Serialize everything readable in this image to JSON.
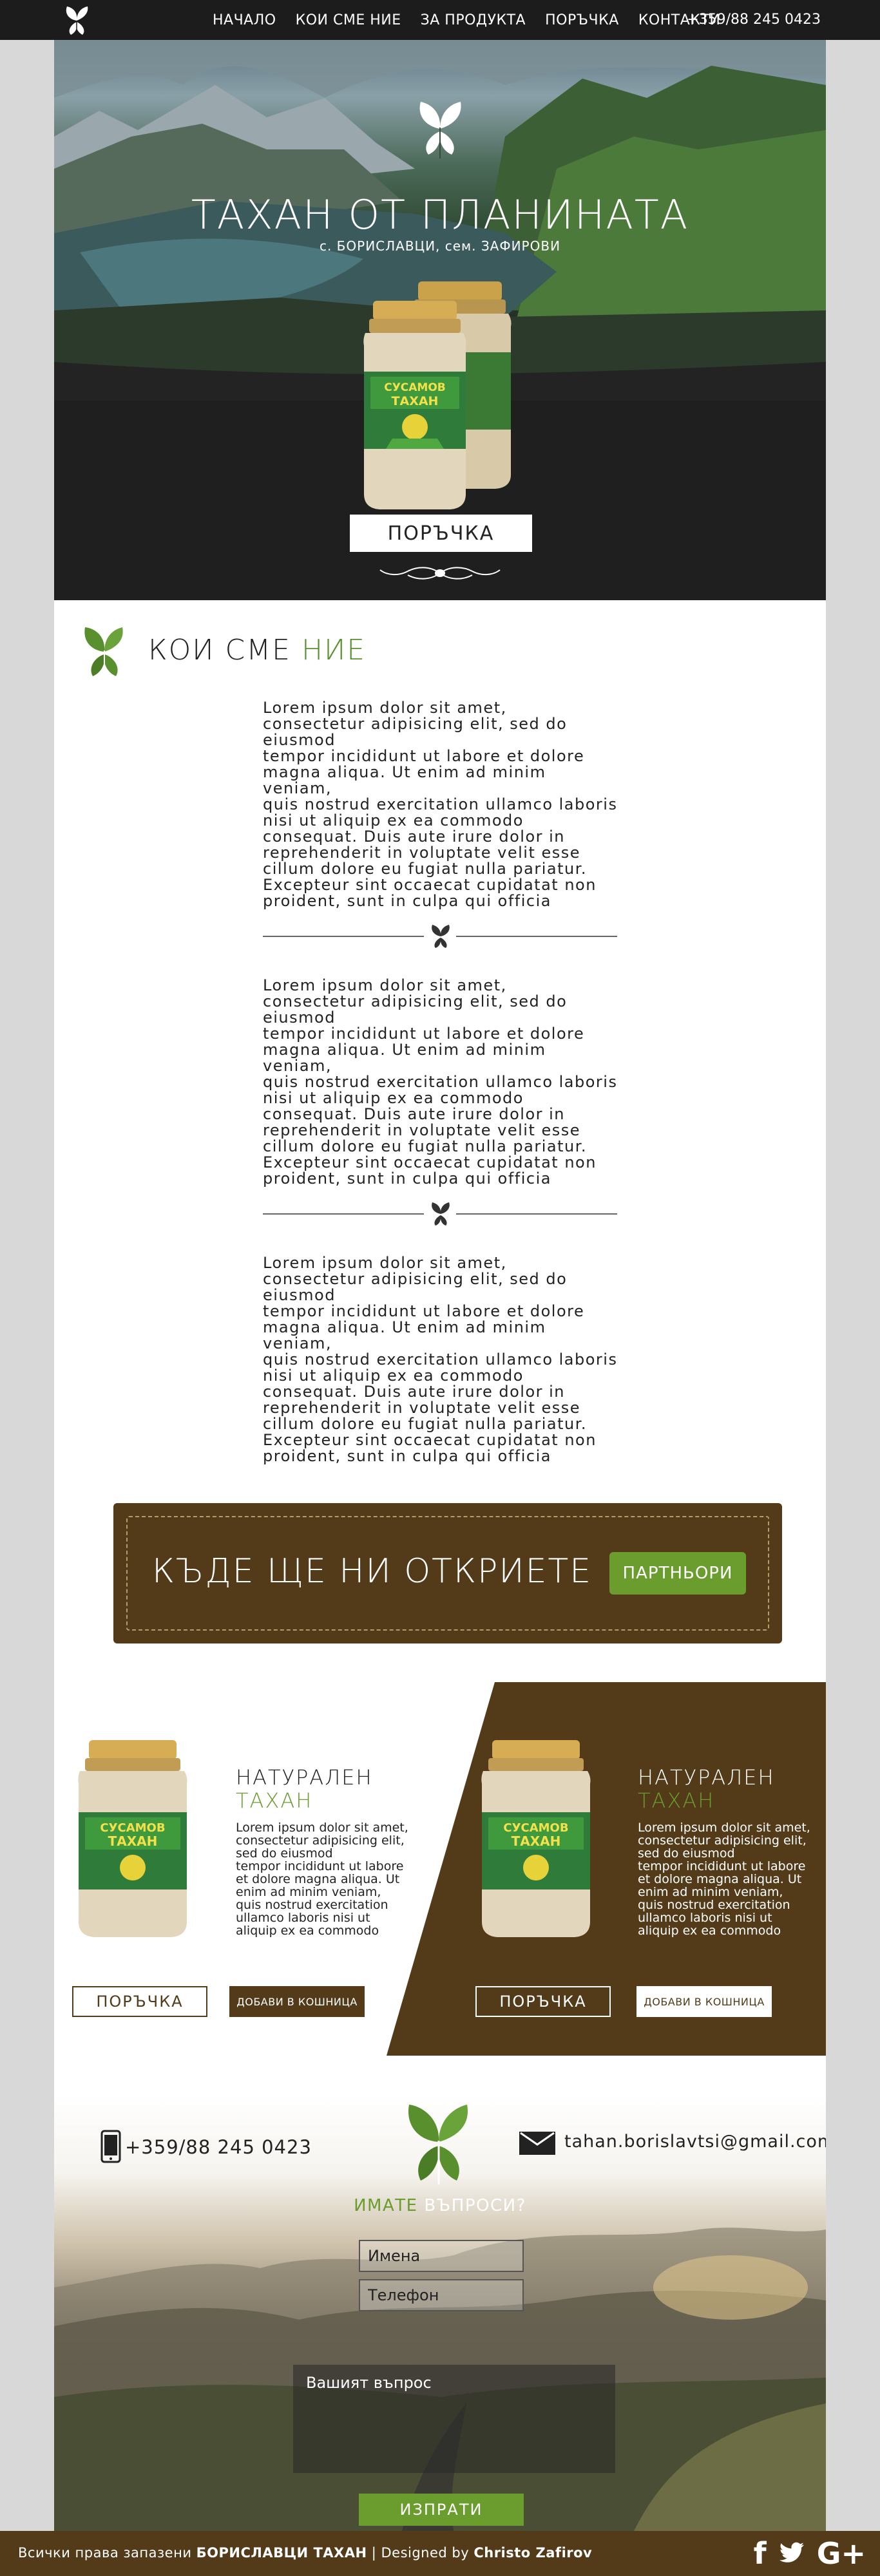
{
  "nav": {
    "links": [
      "НАЧАЛО",
      "КОИ СМЕ НИЕ",
      "ЗА ПРОДУКТА",
      "ПОРЪЧКА",
      "КОНТАКТИ"
    ],
    "phone": "+359/88 245 0423"
  },
  "hero": {
    "title": "ТАХАН ОТ ПЛАНИНАТА",
    "subtitle": "с. БОРИСЛАВЦИ, сем. ЗАФИРОВИ",
    "jar_label_top": "СУСАМОВ",
    "jar_label_bottom": "ТАХАН",
    "order_button": "ПОРЪЧКА"
  },
  "about": {
    "title_main": "КОИ СМЕ ",
    "title_accent": "НИЕ",
    "paragraphs": [
      "      Lorem ipsum dolor sit amet,\nconsectetur adipisicing elit, sed do\neiusmod\ntempor incididunt ut labore et dolore\nmagna aliqua. Ut enim ad minim\nveniam,\nquis nostrud exercitation ullamco laboris\nnisi ut aliquip ex ea commodo\nconsequat. Duis aute irure dolor in\nreprehenderit in voluptate velit esse\ncillum dolore eu fugiat nulla pariatur.\nExcepteur sint occaecat cupidatat non\nproident, sunt in culpa qui officia",
      "      Lorem ipsum dolor sit amet,\nconsectetur adipisicing elit, sed do\neiusmod\ntempor incididunt ut labore et dolore\nmagna aliqua. Ut enim ad minim\nveniam,\nquis nostrud exercitation ullamco laboris\nnisi ut aliquip ex ea commodo\nconsequat. Duis aute irure dolor in\nreprehenderit in voluptate velit esse\ncillum dolore eu fugiat nulla pariatur.\nExcepteur sint occaecat cupidatat non\nproident, sunt in culpa qui officia",
      "      Lorem ipsum dolor sit amet,\nconsectetur adipisicing elit, sed do\neiusmod\ntempor incididunt ut labore et dolore\nmagna aliqua. Ut enim ad minim\nveniam,\nquis nostrud exercitation ullamco laboris\nnisi ut aliquip ex ea commodo\nconsequat. Duis aute irure dolor in\nreprehenderit in voluptate velit esse\ncillum dolore eu fugiat nulla pariatur.\nExcepteur sint occaecat cupidatat non\nproident, sunt in culpa qui officia"
    ]
  },
  "find": {
    "title": "КЪДЕ ЩЕ НИ ОТКРИЕТЕ",
    "button": "ПАРТНЬОРИ"
  },
  "products": [
    {
      "title_main": "НАТУРАЛЕН",
      "title_accent": "ТАХАН",
      "description": "Lorem ipsum dolor sit amet,\nconsectetur adipisicing elit,\nsed do eiusmod\ntempor incididunt ut labore\net dolore magna aliqua. Ut\nenim ad minim veniam,\nquis nostrud exercitation\nullamco laboris nisi ut\naliquip ex ea commodo",
      "order_button": "ПОРЪЧКА",
      "cart_button": "ДОБАВИ В КОШНИЦА"
    },
    {
      "title_main": "НАТУРАЛЕН",
      "title_accent": "ТАХАН",
      "description": "Lorem ipsum dolor sit amet,\nconsectetur adipisicing elit,\nsed do eiusmod\ntempor incididunt ut labore\net dolore magna aliqua. Ut\nenim ad minim veniam,\nquis nostrud exercitation\nullamco laboris nisi ut\naliquip ex ea commodo",
      "order_button": "ПОРЪЧКА",
      "cart_button": "ДОБАВИ В КОШНИЦА"
    }
  ],
  "contact": {
    "phone": "+359/88 245 0423",
    "email": "tahan.borislavtsi@gmail.com",
    "question_accent": "ИМАТЕ",
    "question_main": " ВЪПРОСИ?",
    "name_placeholder": "Имена",
    "phone_placeholder": "Телефон",
    "message_placeholder": "Вашият въпрос",
    "submit": "ИЗПРАТИ"
  },
  "footer": {
    "rights": "Всички права запазени ",
    "brand": "БОРИСЛАВЦИ ТАХАН",
    "divider": " | Designed by ",
    "designer": "Christo Zafirov",
    "social": [
      "f",
      "t",
      "G+"
    ]
  },
  "colors": {
    "brown": "#533a18",
    "green": "#6a9c2e",
    "dark": "#1c1c1c"
  }
}
